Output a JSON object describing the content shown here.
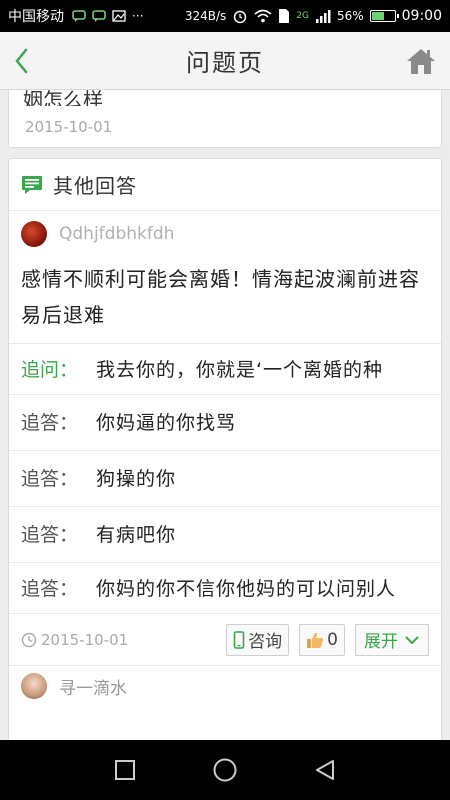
{
  "status_bar": {
    "carrier": "中国移动",
    "network_speed": "324B/s",
    "network_type": "2G",
    "battery": "56%",
    "battery_level": 0.56,
    "time": "09:00"
  },
  "header": {
    "title": "问题页"
  },
  "question_card": {
    "question_tail": "姻怎么样",
    "date": "2015-10-01"
  },
  "other_answers": {
    "section_label": "其他回答",
    "first_answer": {
      "username": "Qdhjfdbhkfdh",
      "answer_text": "感情不顺利可能会离婚！情海起波澜前进容易后退难",
      "follow_ups": [
        {
          "label": "追问：",
          "type": "ask",
          "text": "我去你的，你就是‘一个离婚的种"
        },
        {
          "label": "追答：",
          "type": "answer",
          "text": "你妈逼的你找骂"
        },
        {
          "label": "追答：",
          "type": "answer",
          "text": "狗操的你"
        },
        {
          "label": "追答：",
          "type": "answer",
          "text": "有病吧你"
        },
        {
          "label": "追答：",
          "type": "answer",
          "text": "你妈的你不信你他妈的可以问别人"
        }
      ],
      "date": "2015-10-01",
      "consult_label": "咨询",
      "like_count": "0",
      "expand_label": "展开"
    },
    "next_answer": {
      "username": "寻一滴水"
    }
  },
  "colors": {
    "accent_green": "#3aa54a",
    "background": "#ececec"
  }
}
